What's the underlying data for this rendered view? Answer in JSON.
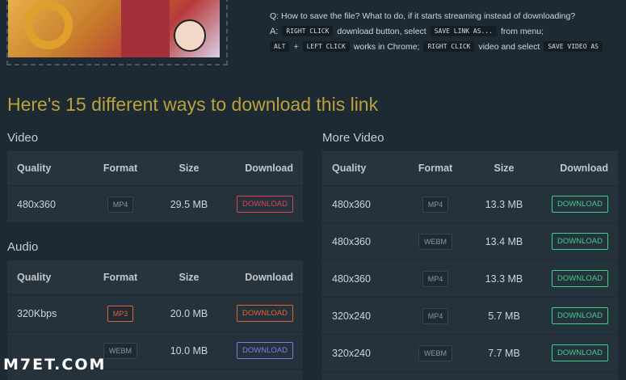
{
  "qa": {
    "question": "Q: How to save the file? What to do, if it starts streaming instead of downloading?",
    "a_label": "A:",
    "right_click": "RIGHT CLICK",
    "text1": "download button, select",
    "save_link_as": "SAVE LINK AS...",
    "text2": "from menu;",
    "alt": "ALT",
    "plus": "+",
    "left_click": "LEFT CLICK",
    "text3": "works in Chrome;",
    "right_click2": "RIGHT CLICK",
    "text4": "video and select",
    "save_video_as": "SAVE VIDEO AS"
  },
  "heading": "Here's 15 different ways to download this link",
  "headers": {
    "quality": "Quality",
    "format": "Format",
    "size": "Size",
    "download": "Download"
  },
  "video": {
    "title": "Video",
    "rows": [
      {
        "quality": "480x360",
        "format": "MP4",
        "size": "29.5 MB",
        "button": "DOWNLOAD"
      }
    ]
  },
  "audio": {
    "title": "Audio",
    "rows": [
      {
        "quality": "320Kbps",
        "format": "MP3",
        "size": "20.0 MB",
        "button": "DOWNLOAD"
      },
      {
        "quality": "",
        "format": "WEBM",
        "size": "10.0 MB",
        "button": "DOWNLOAD"
      }
    ]
  },
  "more_video": {
    "title": "More Video",
    "rows": [
      {
        "quality": "480x360",
        "format": "MP4",
        "size": "13.3 MB",
        "button": "DOWNLOAD"
      },
      {
        "quality": "480x360",
        "format": "WEBM",
        "size": "13.4 MB",
        "button": "DOWNLOAD"
      },
      {
        "quality": "480x360",
        "format": "MP4",
        "size": "13.3 MB",
        "button": "DOWNLOAD"
      },
      {
        "quality": "320x240",
        "format": "MP4",
        "size": "5.7 MB",
        "button": "DOWNLOAD"
      },
      {
        "quality": "320x240",
        "format": "WEBM",
        "size": "7.7 MB",
        "button": "DOWNLOAD"
      }
    ]
  },
  "watermark": "M7ET.COM",
  "colors": {
    "background": "#1d2a34",
    "heading": "#b9a23a",
    "button_red": "#e0434f",
    "button_orange": "#e8602f",
    "button_blue": "#7d7fe8",
    "button_green": "#3fcf8a"
  }
}
